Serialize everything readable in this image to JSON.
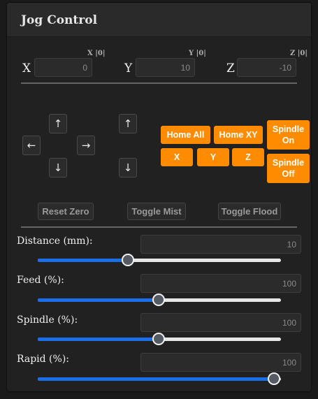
{
  "title": "Jog Control",
  "axes": [
    {
      "letter": "X",
      "tag": "X |0|",
      "value": "0"
    },
    {
      "letter": "Y",
      "tag": "Y |0|",
      "value": "10"
    },
    {
      "letter": "Z",
      "tag": "Z |0|",
      "value": "-10"
    }
  ],
  "jog_icons": {
    "up": "arrow-up-icon",
    "down": "arrow-down-icon",
    "left": "arrow-left-icon",
    "right": "arrow-right-icon"
  },
  "jog_glyphs": {
    "up": "↑",
    "down": "↓",
    "left": "←",
    "right": "→"
  },
  "home": {
    "all": "Home All",
    "xy": "Home XY",
    "x": "X",
    "y": "Y",
    "z": "Z"
  },
  "spindle": {
    "on": "Spindle On",
    "off": "Spindle Off"
  },
  "actions": {
    "reset_zero": "Reset Zero",
    "toggle_mist": "Toggle Mist",
    "toggle_flood": "Toggle Flood"
  },
  "sliders": [
    {
      "label": "Distance (mm):",
      "value": "10",
      "fraction": 0.371
    },
    {
      "label": "Feed (%):",
      "value": "100",
      "fraction": 0.498
    },
    {
      "label": "Spindle (%):",
      "value": "100",
      "fraction": 0.498
    },
    {
      "label": "Rapid (%):",
      "value": "100",
      "fraction": 0.97
    }
  ],
  "colors": {
    "accent": "#ff8c00",
    "slider_fill": "#1a6fe8"
  }
}
